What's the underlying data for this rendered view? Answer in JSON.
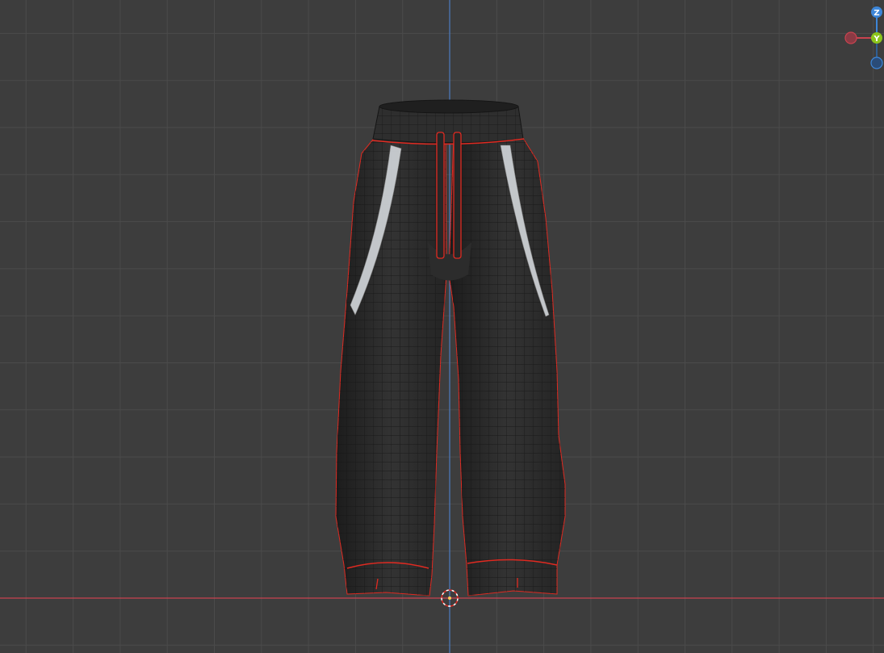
{
  "colors": {
    "background": "#3d3d3d",
    "grid_line": "#4b4b4b",
    "x_axis": "#c9434f",
    "z_axis": "#4d7cc1",
    "axis_x_gizmo": "#c9434f",
    "axis_y_gizmo": "#8cc51c",
    "axis_z_gizmo": "#3d86d8",
    "axis_negative_z": "#2f5f95",
    "mesh_fill": "#2a2a2a",
    "mesh_wire": "#151515",
    "seam": "#e02a21",
    "pocket_highlight": "#d0d4d8"
  },
  "gizmo": {
    "z_label": "Z",
    "y_label": "Y"
  },
  "icons": {
    "gizmo": "navigation-gizmo-icon",
    "cursor": "3d-cursor-icon"
  }
}
